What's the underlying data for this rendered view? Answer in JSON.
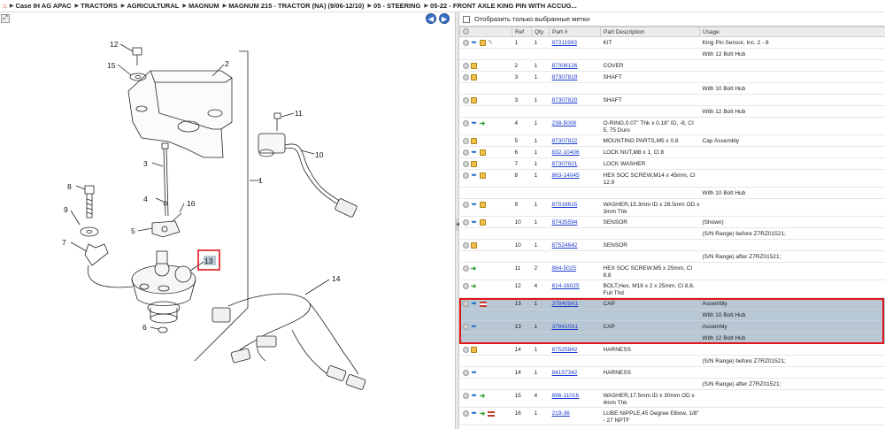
{
  "breadcrumb": [
    "Case IH AG APAC",
    "TRACTORS",
    "AGRICULTURAL",
    "MAGNUM",
    "MAGNUM 215 - TRACTOR (NA) (9/06-12/10)",
    "05 - STEERING",
    "05-22 - FRONT AXLE KING PIN WITH ACCUG..."
  ],
  "diagram": {
    "callouts": [
      "12",
      "15",
      "2",
      "11",
      "10",
      "3",
      "1",
      "8",
      "4",
      "16",
      "9",
      "5",
      "7",
      "13",
      "14",
      "6"
    ],
    "selected_callout": "13",
    "nav": {
      "prev": "◀",
      "next": "▶"
    },
    "fit_icon": "⤢"
  },
  "filter": {
    "label": "Отобразить только выбранные метки",
    "checked": false
  },
  "table": {
    "headers": [
      "",
      "Ref",
      "Qty",
      "Part #",
      "Part Description",
      "Usage"
    ],
    "rows": [
      {
        "icons": [
          "view",
          "info",
          "box",
          "tool"
        ],
        "ref": "1",
        "qty": "1",
        "part": "87311993",
        "desc": "KIT",
        "usage": "King Pin Sensor, Inc. 2 - 8"
      },
      {
        "icons": [],
        "ref": "",
        "qty": "",
        "part": "",
        "desc": "",
        "usage": "With 12 Bolt Hub"
      },
      {
        "icons": [
          "view",
          "box"
        ],
        "ref": "2",
        "qty": "1",
        "part": "87308126",
        "desc": "COVER",
        "usage": ""
      },
      {
        "icons": [
          "view",
          "box"
        ],
        "ref": "3",
        "qty": "1",
        "part": "87307819",
        "desc": "SHAFT",
        "usage": ""
      },
      {
        "icons": [],
        "ref": "",
        "qty": "",
        "part": "",
        "desc": "",
        "usage": "With 10 Bolt Hub"
      },
      {
        "icons": [
          "view",
          "box"
        ],
        "ref": "3",
        "qty": "1",
        "part": "87307820",
        "desc": "SHAFT",
        "usage": ""
      },
      {
        "icons": [],
        "ref": "",
        "qty": "",
        "part": "",
        "desc": "",
        "usage": "With 12 Bolt Hub"
      },
      {
        "icons": [
          "view",
          "info",
          "go"
        ],
        "ref": "4",
        "qty": "1",
        "part": "238-5008",
        "desc": "O-RING,0.07\" Thk x 0.18\" ID, -8, CI 5, 75 Duro",
        "usage": "",
        "tall": true
      },
      {
        "icons": [
          "view",
          "box"
        ],
        "ref": "5",
        "qty": "1",
        "part": "87307822",
        "desc": "MOUNTING PARTS,M5 x 0.8",
        "usage": "Cap Assembly"
      },
      {
        "icons": [
          "view",
          "info",
          "box"
        ],
        "ref": "6",
        "qty": "1",
        "part": "832-10406",
        "desc": "LOCK NUT,M8 x 1, Cl 8",
        "usage": ""
      },
      {
        "icons": [
          "view",
          "box"
        ],
        "ref": "7",
        "qty": "1",
        "part": "87307821",
        "desc": "LOCK WASHER",
        "usage": ""
      },
      {
        "icons": [
          "view",
          "info",
          "box"
        ],
        "ref": "8",
        "qty": "1",
        "part": "863-14045",
        "desc": "HEX SOC SCREW,M14 x 45mm, Cl 12.9",
        "usage": ""
      },
      {
        "icons": [],
        "ref": "",
        "qty": "",
        "part": "",
        "desc": "",
        "usage": "With 10 Bolt Hub"
      },
      {
        "icons": [
          "view",
          "info",
          "box"
        ],
        "ref": "9",
        "qty": "1",
        "part": "87016615",
        "desc": "WASHER,15.3mm ID x 28.5mm OD x 3mm Thk",
        "usage": "",
        "tall": true
      },
      {
        "icons": [
          "view",
          "info",
          "box"
        ],
        "ref": "10",
        "qty": "1",
        "part": "87435594",
        "desc": "SENSOR",
        "usage": "(Shown)"
      },
      {
        "icons": [],
        "ref": "",
        "qty": "",
        "part": "",
        "desc": "",
        "usage": "(S/N Range) before Z7RZ01521;"
      },
      {
        "icons": [
          "view",
          "box"
        ],
        "ref": "10",
        "qty": "1",
        "part": "87524642",
        "desc": "SENSOR",
        "usage": ""
      },
      {
        "icons": [],
        "ref": "",
        "qty": "",
        "part": "",
        "desc": "",
        "usage": "(S/N Range) after Z7RZ01521;"
      },
      {
        "icons": [
          "view",
          "go"
        ],
        "ref": "11",
        "qty": "2",
        "part": "864-5025",
        "desc": "HEX SOC SCREW,M5 x 25mm, Cl 8.8",
        "usage": ""
      },
      {
        "icons": [
          "view",
          "go"
        ],
        "ref": "12",
        "qty": "4",
        "part": "614-16025",
        "desc": "BOLT,Hex, M16 x 2 x 25mm, Cl 8.8, Full Thd",
        "usage": "",
        "tall": true
      },
      {
        "icons": [
          "view",
          "info",
          "flag"
        ],
        "ref": "13",
        "qty": "1",
        "part": "378409A1",
        "desc": "CAP",
        "usage": "Assembly",
        "sel": true
      },
      {
        "icons": [],
        "ref": "",
        "qty": "",
        "part": "",
        "desc": "",
        "usage": "With 10 Bolt Hub",
        "sel": true
      },
      {
        "icons": [
          "view",
          "info"
        ],
        "ref": "13",
        "qty": "1",
        "part": "378410A1",
        "desc": "CAP",
        "usage": "Assembly",
        "sel": true
      },
      {
        "icons": [],
        "ref": "",
        "qty": "",
        "part": "",
        "desc": "",
        "usage": "With 12 Bolt Hub",
        "sel": true
      },
      {
        "icons": [
          "view",
          "box"
        ],
        "ref": "14",
        "qty": "1",
        "part": "87525842",
        "desc": "HARNESS",
        "usage": ""
      },
      {
        "icons": [],
        "ref": "",
        "qty": "",
        "part": "",
        "desc": "",
        "usage": "(S/N Range) before Z7RZ01521;"
      },
      {
        "icons": [
          "view",
          "info"
        ],
        "ref": "14",
        "qty": "1",
        "part": "84157342",
        "desc": "HARNESS",
        "usage": ""
      },
      {
        "icons": [],
        "ref": "",
        "qty": "",
        "part": "",
        "desc": "",
        "usage": "(S/N Range) after Z7RZ01521;"
      },
      {
        "icons": [
          "view",
          "info",
          "go"
        ],
        "ref": "15",
        "qty": "4",
        "part": "896-11016",
        "desc": "WASHER,17.5mm ID x 30mm OD x 4mm Thk",
        "usage": "",
        "tall": true
      },
      {
        "icons": [
          "view",
          "info",
          "go",
          "flag"
        ],
        "ref": "16",
        "qty": "1",
        "part": "219-36",
        "desc": "LUBE NIPPLE,45 Degree Elbow, 1/8\" - 27 NPTF",
        "usage": "",
        "tall": true
      }
    ]
  },
  "colors": {
    "selected_row": "#b7c7d3",
    "highlight_border": "#e0161a",
    "link": "#1a3ccc",
    "nav_button": "#3b6fc4"
  }
}
